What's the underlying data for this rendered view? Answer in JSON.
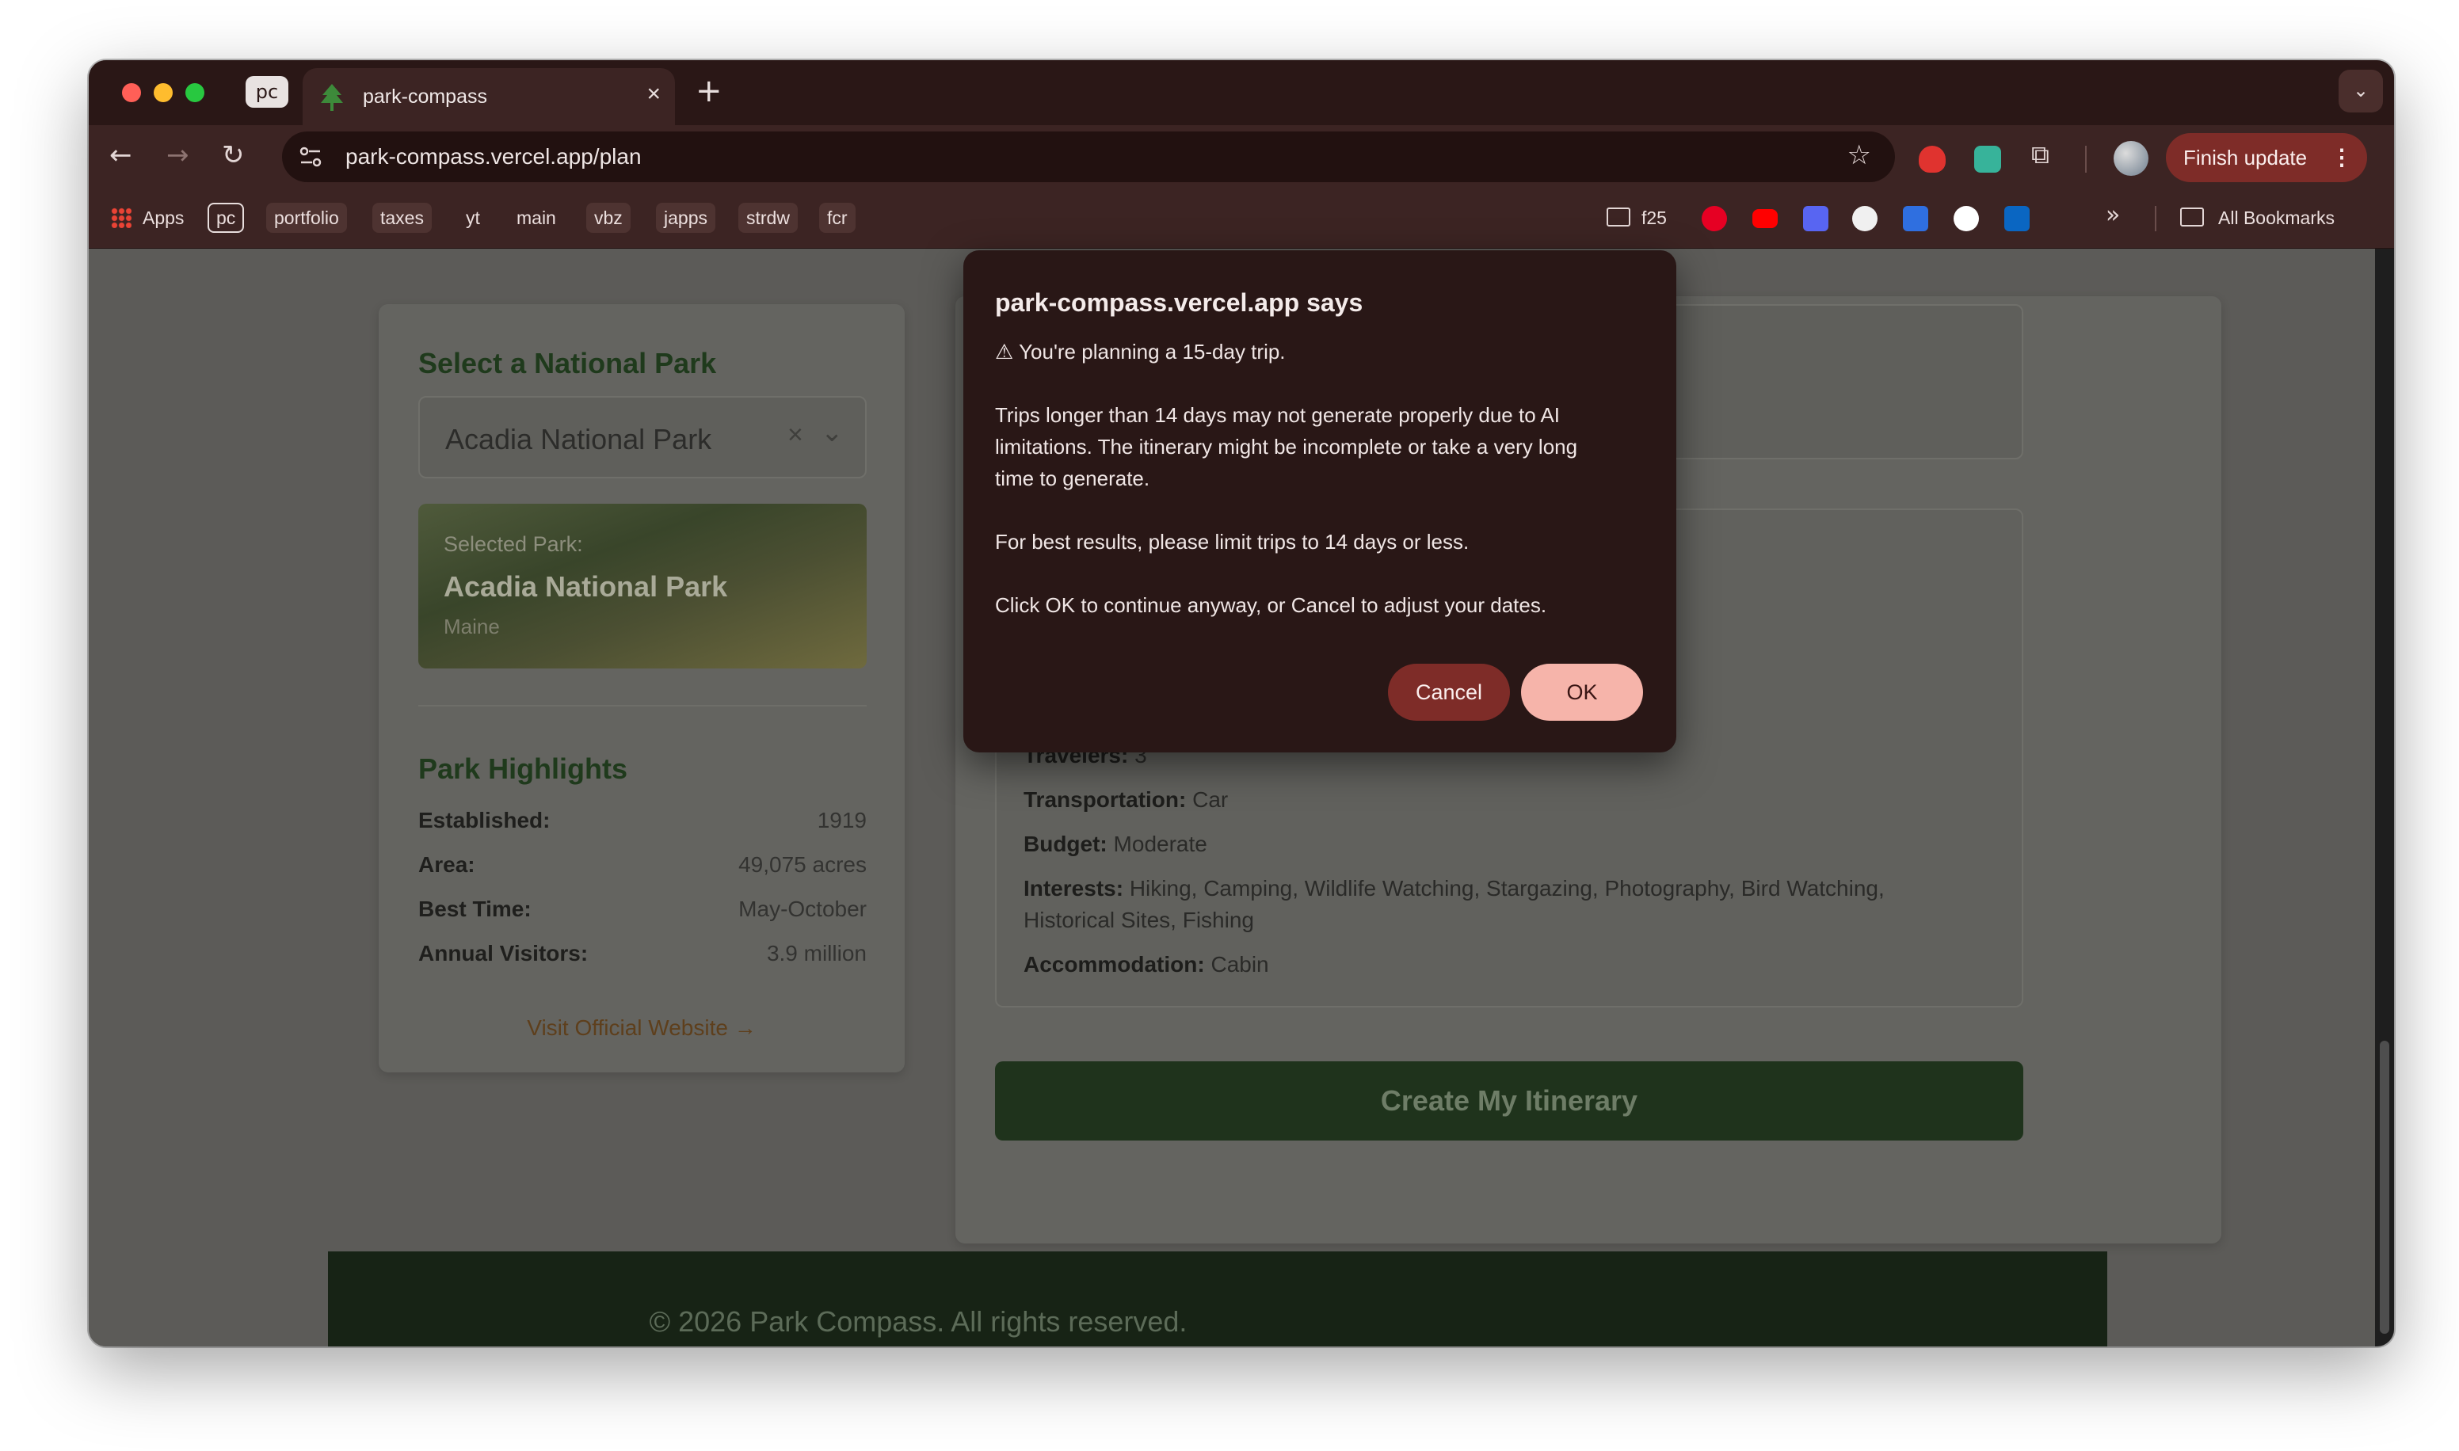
{
  "browser": {
    "profile_badge": "pc",
    "tab": {
      "title": "park-compass",
      "close_glyph": "×"
    },
    "new_tab_glyph": "+",
    "tab_search_glyph": "⌄",
    "url": "park-compass.vercel.app/plan",
    "finish_update_label": "Finish update",
    "menu_glyph": "⋮",
    "bookmarks": {
      "apps_label": "Apps",
      "items": [
        "pc",
        "portfolio",
        "taxes",
        "yt",
        "main",
        "vbz",
        "japps",
        "strdw",
        "fcr"
      ],
      "folder_label": "f25",
      "overflow_glyph": "»",
      "all_bookmarks_label": "All Bookmarks"
    }
  },
  "page": {
    "select_heading": "Select a National Park",
    "selected_value": "Acadia National Park",
    "clear_glyph": "×",
    "selected_card": {
      "label": "Selected Park:",
      "name": "Acadia National Park",
      "state": "Maine"
    },
    "highlights_heading": "Park Highlights",
    "highlights": [
      {
        "key": "Established:",
        "value": "1919"
      },
      {
        "key": "Area:",
        "value": "49,075 acres"
      },
      {
        "key": "Best Time:",
        "value": "May-October"
      },
      {
        "key": "Annual Visitors:",
        "value": "3.9 million"
      }
    ],
    "visit_link": "Visit Official Website →",
    "summary": {
      "travelers_label": "Travelers:",
      "travelers": "3",
      "transportation_label": "Transportation:",
      "transportation": "Car",
      "budget_label": "Budget:",
      "budget": "Moderate",
      "interests_label": "Interests:",
      "interests_line1": "Hiking, Camping, Wildlife Watching, Stargazing, Photography, Bird Watching,",
      "interests_line2": "Historical Sites, Fishing",
      "accommodation_label": "Accommodation:",
      "accommodation": "Cabin"
    },
    "create_button": "Create My Itinerary",
    "footer": "© 2026 Park Compass. All rights reserved."
  },
  "dialog": {
    "title": "park-compass.vercel.app says",
    "line1": "⚠ You're planning a 15-day trip.",
    "line2a": "Trips longer than 14 days may not generate properly due to AI",
    "line2b": "limitations. The itinerary might be incomplete or take a very long",
    "line2c": "time to generate.",
    "line3": "For best results, please limit trips to 14 days or less.",
    "line4": "Click OK to continue anyway, or Cancel to adjust your dates.",
    "cancel_label": "Cancel",
    "ok_label": "OK"
  },
  "colors": {
    "chrome_bg": "#3c2423",
    "accent_button": "#7e2c28",
    "ok_button": "#f6b4aa",
    "park_green": "#1f331c"
  }
}
